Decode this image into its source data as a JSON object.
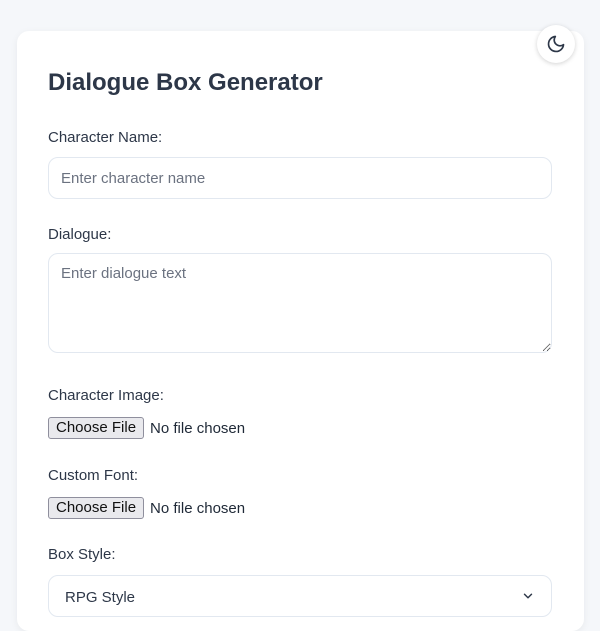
{
  "app": {
    "title": "Dialogue Box Generator",
    "theme_toggle_icon": "moon-icon"
  },
  "form": {
    "character_name": {
      "label": "Character Name:",
      "placeholder": "Enter character name",
      "value": ""
    },
    "dialogue": {
      "label": "Dialogue:",
      "placeholder": "Enter dialogue text",
      "value": ""
    },
    "character_image": {
      "label": "Character Image:",
      "button_label": "Choose File",
      "status": "No file chosen"
    },
    "custom_font": {
      "label": "Custom Font:",
      "button_label": "Choose File",
      "status": "No file chosen"
    },
    "box_style": {
      "label": "Box Style:",
      "selected": "RPG Style",
      "icon": "chevron-down-icon"
    }
  },
  "colors": {
    "background": "#f5f7fa",
    "card": "#ffffff",
    "text": "#2d3748",
    "placeholder": "#6b7280",
    "input_border": "#e2e8f0"
  }
}
